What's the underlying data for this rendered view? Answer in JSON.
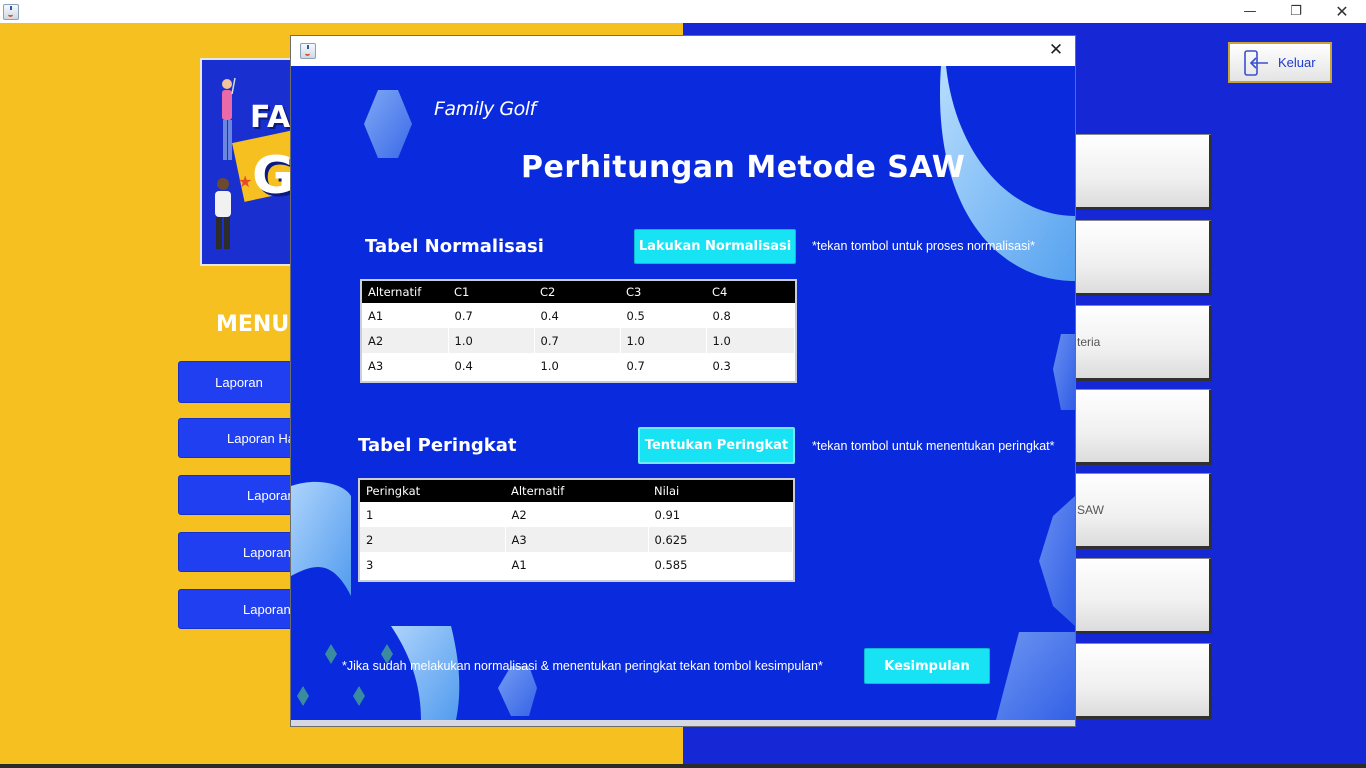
{
  "colors": {
    "yellow": "#f6c020",
    "blue_bg": "#1627d6",
    "dialog_blue": "#0a2bdd",
    "cyan_button": "#18e3f5",
    "menu_button": "#1f3ff0"
  },
  "main_window": {
    "app_icon": "java-icon",
    "controls": [
      "minimize-icon",
      "restore-icon",
      "close-icon"
    ]
  },
  "logo": {
    "line1": "FA",
    "line2": "GO"
  },
  "menu": {
    "title": "MENU",
    "items": [
      {
        "label": "Laporan"
      },
      {
        "label": "Laporan Ha"
      },
      {
        "label": "Laporan"
      },
      {
        "label": "Laporan"
      },
      {
        "label": "Laporan"
      }
    ]
  },
  "right_panel": {
    "keluar_label": "Keluar",
    "buttons": [
      {
        "label": ""
      },
      {
        "label": ""
      },
      {
        "label": "teria"
      },
      {
        "label": ""
      },
      {
        "label": "SAW"
      },
      {
        "label": ""
      },
      {
        "label": ""
      }
    ]
  },
  "dialog": {
    "brand": "Family Golf",
    "title": "Perhitungan Metode SAW",
    "normalisasi": {
      "section_title": "Tabel Normalisasi",
      "button_label": "Lakukan Normalisasi",
      "hint": "*tekan tombol untuk proses normalisasi*",
      "columns": [
        "Alternatif",
        "C1",
        "C2",
        "C3",
        "C4"
      ],
      "rows": [
        [
          "A1",
          "0.7",
          "0.4",
          "0.5",
          "0.8"
        ],
        [
          "A2",
          "1.0",
          "0.7",
          "1.0",
          "1.0"
        ],
        [
          "A3",
          "0.4",
          "1.0",
          "0.7",
          "0.3"
        ]
      ]
    },
    "peringkat": {
      "section_title": "Tabel Peringkat",
      "button_label": "Tentukan Peringkat",
      "hint": "*tekan tombol untuk menentukan peringkat*",
      "columns": [
        "Peringkat",
        "Alternatif",
        "Nilai"
      ],
      "rows": [
        [
          "1",
          "A2",
          "0.91"
        ],
        [
          "2",
          "A3",
          "0.625"
        ],
        [
          "3",
          "A1",
          "0.585"
        ]
      ]
    },
    "footer_hint": "*Jika sudah melakukan normalisasi & menentukan peringkat tekan tombol kesimpulan*",
    "kesimpulan_label": "Kesimpulan"
  }
}
